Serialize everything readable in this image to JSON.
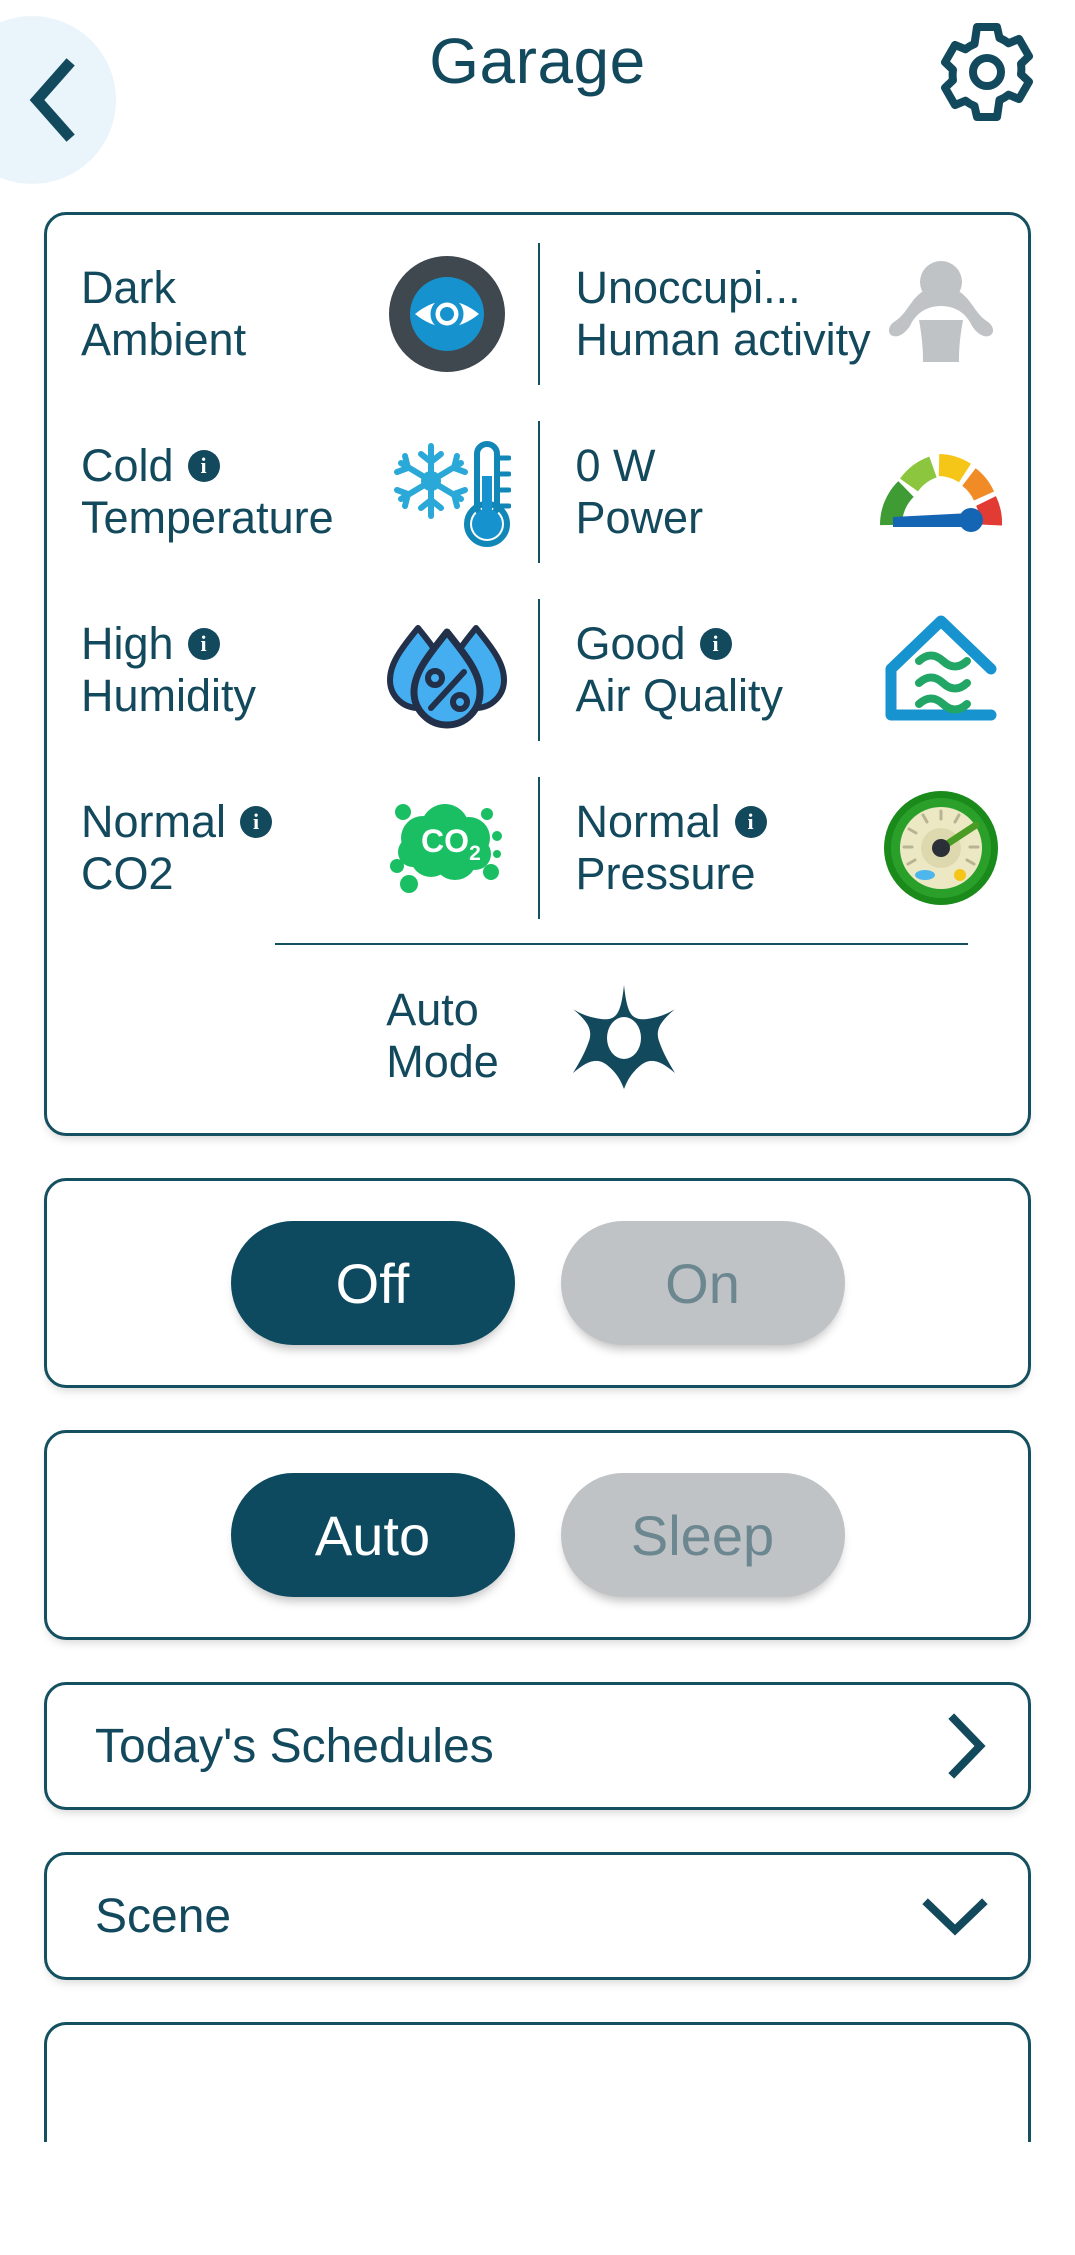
{
  "theme": {
    "primary": "#13495c",
    "active_button_bg": "#0d4a60",
    "inactive_button_bg": "#bfc3c5",
    "inactive_button_text": "#6c8790",
    "back_circle_bg": "#e9f5fb",
    "card_border": "#14505f"
  },
  "header": {
    "title": "Garage",
    "back_icon": "chevron-left-icon",
    "settings_icon": "gear-icon"
  },
  "sensors": {
    "rows": [
      {
        "left": {
          "value": "Dark",
          "label": "Ambient",
          "has_info": false,
          "icon": "eye-ambient-light-icon"
        },
        "right": {
          "value": "Unoccupi...",
          "label": "Human activity",
          "has_info": false,
          "icon": "person-presence-icon"
        }
      },
      {
        "left": {
          "value": "Cold",
          "label": "Temperature",
          "has_info": true,
          "icon": "snowflake-thermometer-icon"
        },
        "right": {
          "value": "0 W",
          "label": "Power",
          "has_info": false,
          "icon": "power-gauge-icon"
        }
      },
      {
        "left": {
          "value": "High",
          "label": "Humidity",
          "has_info": true,
          "icon": "humidity-droplets-icon"
        },
        "right": {
          "value": "Good",
          "label": "Air Quality",
          "has_info": true,
          "icon": "house-airflow-icon"
        }
      },
      {
        "left": {
          "value": "Normal",
          "label": "CO2",
          "has_info": true,
          "icon": "co2-cloud-icon"
        },
        "right": {
          "value": "Normal",
          "label": "Pressure",
          "has_info": true,
          "icon": "barometer-icon"
        }
      }
    ],
    "mode": {
      "value": "Auto",
      "label": "Mode",
      "icon": "fan-rotor-icon"
    },
    "info_glyph": "i"
  },
  "power_toggle": {
    "options": [
      {
        "label": "Off",
        "active": true
      },
      {
        "label": "On",
        "active": false
      }
    ]
  },
  "mode_toggle": {
    "options": [
      {
        "label": "Auto",
        "active": true
      },
      {
        "label": "Sleep",
        "active": false
      }
    ]
  },
  "schedules_row": {
    "label": "Today's Schedules",
    "icon": "chevron-right-icon"
  },
  "scene_row": {
    "label": "Scene",
    "icon": "chevron-down-icon"
  }
}
